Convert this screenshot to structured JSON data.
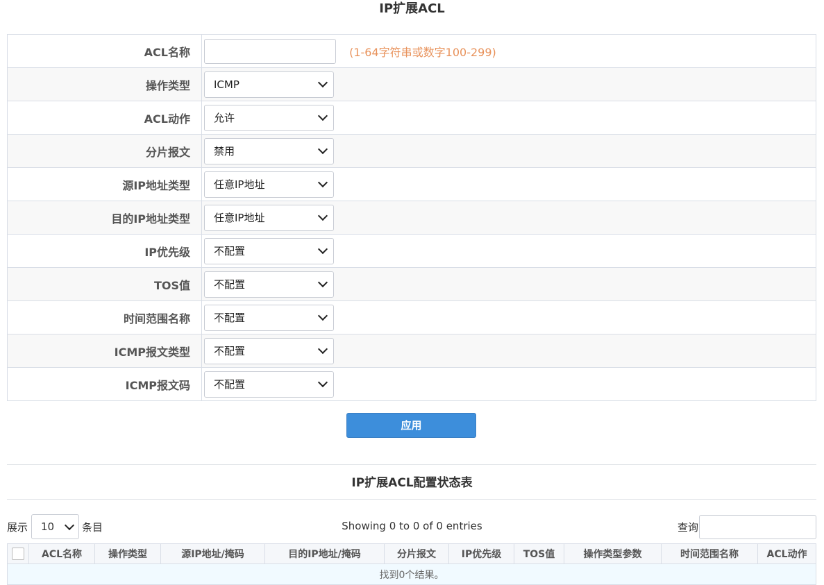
{
  "page_title": "IP扩展ACL",
  "form": {
    "acl_name": {
      "label": "ACL名称",
      "value": "",
      "hint": "(1-64字符串或数字100-299)"
    },
    "op_type": {
      "label": "操作类型",
      "selected": "ICMP"
    },
    "acl_action": {
      "label": "ACL动作",
      "selected": "允许"
    },
    "fragment": {
      "label": "分片报文",
      "selected": "禁用"
    },
    "src_ip_type": {
      "label": "源IP地址类型",
      "selected": "任意IP地址"
    },
    "dst_ip_type": {
      "label": "目的IP地址类型",
      "selected": "任意IP地址"
    },
    "ip_precedence": {
      "label": "IP优先级",
      "selected": "不配置"
    },
    "tos": {
      "label": "TOS值",
      "selected": "不配置"
    },
    "time_range": {
      "label": "时间范围名称",
      "selected": "不配置"
    },
    "icmp_type": {
      "label": "ICMP报文类型",
      "selected": "不配置"
    },
    "icmp_code": {
      "label": "ICMP报文码",
      "selected": "不配置"
    }
  },
  "apply_label": "应用",
  "status": {
    "title": "IP扩展ACL配置状态表",
    "length_prefix": "展示",
    "length_value": "10",
    "length_suffix": "条目",
    "info": "Showing 0 to 0 of 0 entries",
    "search_label": "查询",
    "search_value": "",
    "columns": [
      "ACL名称",
      "操作类型",
      "源IP地址/掩码",
      "目的IP地址/掩码",
      "分片报文",
      "IP优先级",
      "TOS值",
      "操作类型参数",
      "时间范围名称",
      "ACL动作"
    ],
    "empty_text": "找到0个结果。"
  }
}
